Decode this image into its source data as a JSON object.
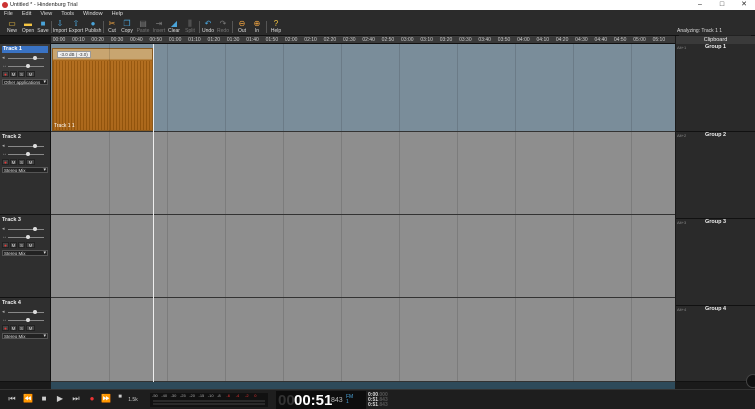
{
  "window": {
    "title": "Untitled * - Hindenburg Trial",
    "minimize": "–",
    "maximize": "□",
    "close": "✕"
  },
  "menu": [
    "File",
    "Edit",
    "View",
    "Tools",
    "Window",
    "Help"
  ],
  "toolbar": [
    "New",
    "Open",
    "Save",
    "Import",
    "Export",
    "Publish",
    "Cut",
    "Copy",
    "Paste",
    "Insert",
    "Clear",
    "Split",
    "Undo",
    "Redo",
    "Out",
    "In",
    "Help"
  ],
  "status": {
    "analyzing": "Analyzing: Track 1 1",
    "progress": 0.97,
    "progress_color": "#7fd040"
  },
  "ruler": [
    "00:00",
    "00:10",
    "00:20",
    "00:30",
    "00:40",
    "00:50",
    "01:00",
    "01:10",
    "01:20",
    "01:30",
    "01:40",
    "01:50",
    "02:00",
    "02:10",
    "02:20",
    "02:30",
    "02:40",
    "02:50",
    "03:00",
    "03:10",
    "03:20",
    "03:30",
    "03:40",
    "03:50",
    "04:00",
    "04:10",
    "04:20",
    "04:30",
    "04:40",
    "04:50",
    "05:00",
    "05:10"
  ],
  "tracks": [
    {
      "name": "Track 1",
      "input": "Other applications",
      "clip": {
        "name": "Track 1 1",
        "level": "-3.0 dB ( -3.0)"
      }
    },
    {
      "name": "Track 2",
      "input": "Stereo Mix"
    },
    {
      "name": "Track 3",
      "input": "Stereo Mix"
    },
    {
      "name": "Track 4",
      "input": "Stereo Mix"
    }
  ],
  "clipboard": {
    "title": "Clipboard",
    "groups": [
      {
        "key": "Alt+1",
        "name": "Group 1"
      },
      {
        "key": "Alt+2",
        "name": "Group 2"
      },
      {
        "key": "Alt+3",
        "name": "Group 3"
      },
      {
        "key": "Alt+4",
        "name": "Group 4"
      }
    ]
  },
  "transport": {
    "rate": "1.5k",
    "meter_ticks": [
      "-50",
      "-40",
      "-30",
      "-25",
      "-20",
      "-15",
      "-10",
      "-8",
      "-6",
      "-4",
      "-2",
      "0"
    ],
    "hours": "00",
    "time": "00:51",
    "frames": "843",
    "fmt": [
      "FM",
      "1"
    ],
    "t1": "0:00",
    "t1f": ".000",
    "t2": "0:51",
    "t2f": ".843",
    "t3": "0:51",
    "t3f": ".843"
  },
  "colors": {
    "track_selected_lane": "#7a8d9a",
    "track_lane": "#8e8e8e",
    "clip": "#a8661a",
    "accent": "#3a73c4"
  }
}
